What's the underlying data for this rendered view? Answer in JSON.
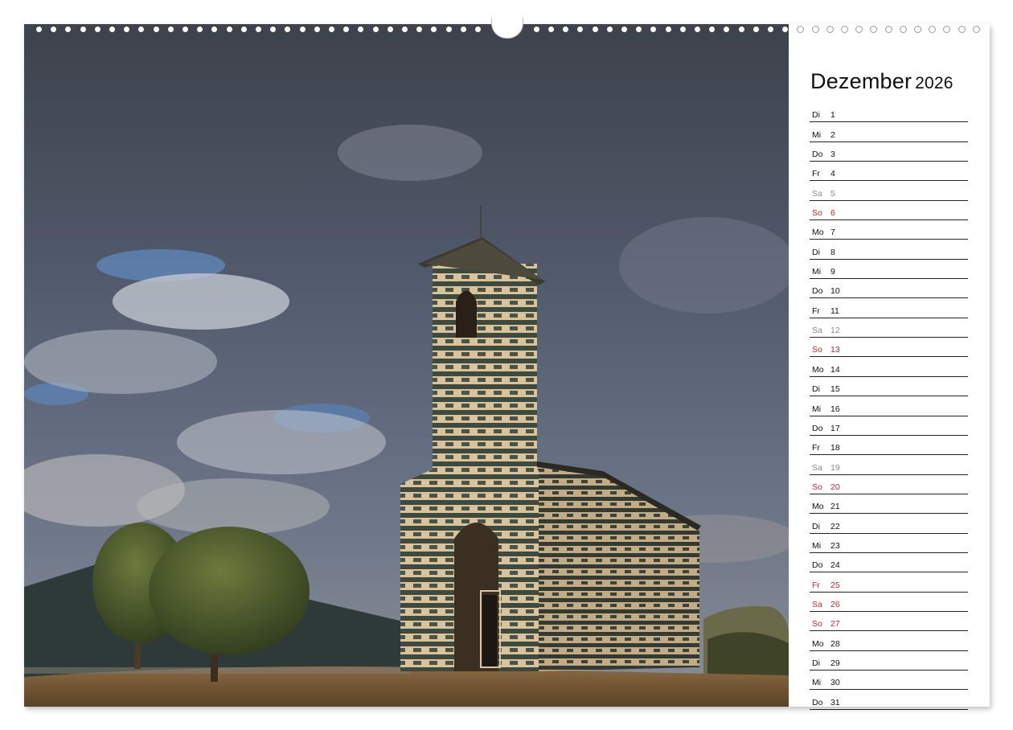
{
  "calendar": {
    "month": "Dezember",
    "year": "2026",
    "days": [
      {
        "wd": "Di",
        "n": "1",
        "type": "weekday"
      },
      {
        "wd": "Mi",
        "n": "2",
        "type": "weekday"
      },
      {
        "wd": "Do",
        "n": "3",
        "type": "weekday"
      },
      {
        "wd": "Fr",
        "n": "4",
        "type": "weekday"
      },
      {
        "wd": "Sa",
        "n": "5",
        "type": "saturday"
      },
      {
        "wd": "So",
        "n": "6",
        "type": "holiday"
      },
      {
        "wd": "Mo",
        "n": "7",
        "type": "weekday"
      },
      {
        "wd": "Di",
        "n": "8",
        "type": "weekday"
      },
      {
        "wd": "Mi",
        "n": "9",
        "type": "weekday"
      },
      {
        "wd": "Do",
        "n": "10",
        "type": "weekday"
      },
      {
        "wd": "Fr",
        "n": "11",
        "type": "weekday"
      },
      {
        "wd": "Sa",
        "n": "12",
        "type": "saturday"
      },
      {
        "wd": "So",
        "n": "13",
        "type": "holiday"
      },
      {
        "wd": "Mo",
        "n": "14",
        "type": "weekday"
      },
      {
        "wd": "Di",
        "n": "15",
        "type": "weekday"
      },
      {
        "wd": "Mi",
        "n": "16",
        "type": "weekday"
      },
      {
        "wd": "Do",
        "n": "17",
        "type": "weekday"
      },
      {
        "wd": "Fr",
        "n": "18",
        "type": "weekday"
      },
      {
        "wd": "Sa",
        "n": "19",
        "type": "saturday"
      },
      {
        "wd": "So",
        "n": "20",
        "type": "holiday"
      },
      {
        "wd": "Mo",
        "n": "21",
        "type": "weekday"
      },
      {
        "wd": "Di",
        "n": "22",
        "type": "weekday"
      },
      {
        "wd": "Mi",
        "n": "23",
        "type": "weekday"
      },
      {
        "wd": "Do",
        "n": "24",
        "type": "weekday"
      },
      {
        "wd": "Fr",
        "n": "25",
        "type": "holiday"
      },
      {
        "wd": "Sa",
        "n": "26",
        "type": "holiday"
      },
      {
        "wd": "So",
        "n": "27",
        "type": "holiday"
      },
      {
        "wd": "Mo",
        "n": "28",
        "type": "weekday"
      },
      {
        "wd": "Di",
        "n": "29",
        "type": "weekday"
      },
      {
        "wd": "Mi",
        "n": "30",
        "type": "weekday"
      },
      {
        "wd": "Do",
        "n": "31",
        "type": "weekday"
      }
    ]
  },
  "colors": {
    "holiday": "#c0282a",
    "saturday": "#8a8a8a",
    "text": "#111111"
  },
  "photo": {
    "subject_icon": "chapel-photo"
  }
}
